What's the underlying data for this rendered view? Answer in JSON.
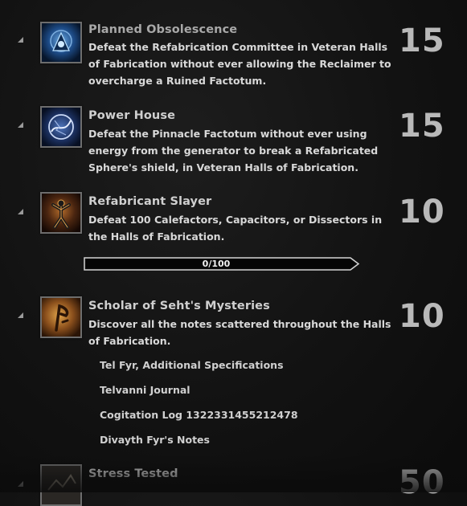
{
  "achievements": [
    {
      "title": "Planned Obsolescence",
      "description": "Defeat the Refabrication Committee in Veteran Halls of Fabrication without ever allowing the Reclaimer to overcharge a Ruined Factotum.",
      "points": "15",
      "icon": "planned-obsolescence-icon"
    },
    {
      "title": "Power House",
      "description": "Defeat the Pinnacle Factotum without ever using energy from the generator to break a Refabricated Sphere's shield, in Veteran Halls of Fabrication.",
      "points": "15",
      "icon": "power-house-icon"
    },
    {
      "title": "Refabricant Slayer",
      "description": "Defeat 100 Calefactors, Capacitors, or Dissectors in the Halls of Fabrication.",
      "points": "10",
      "icon": "refabricant-slayer-icon",
      "progress": {
        "text": "0/100",
        "current": 0,
        "max": 100
      }
    },
    {
      "title": "Scholar of Seht's Mysteries",
      "description": "Discover all the notes scattered throughout the Halls of Fabrication.",
      "points": "10",
      "icon": "scholar-icon",
      "notes": [
        "Tel Fyr, Additional Specifications",
        "Telvanni Journal",
        "Cogitation Log 1322331455212478",
        "Divayth Fyr's Notes"
      ]
    },
    {
      "title": "Stress Tested",
      "points": "50",
      "icon": "stress-tested-icon"
    }
  ]
}
